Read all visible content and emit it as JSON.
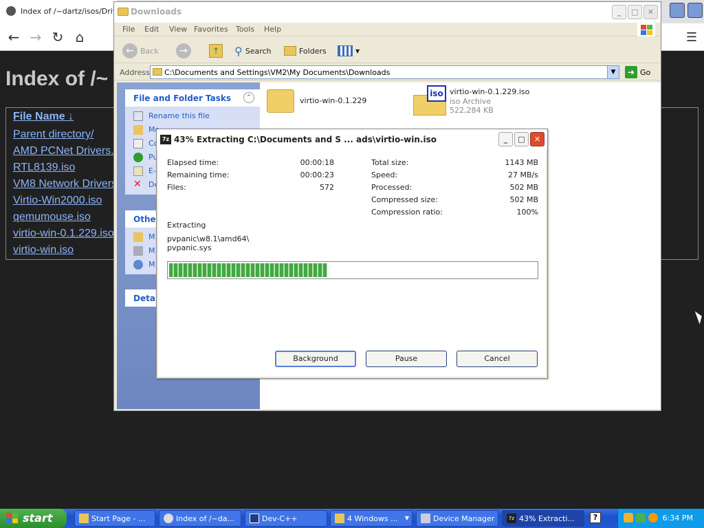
{
  "browser": {
    "tab_title": "Index of /~dartz/isos/Drivers",
    "page_heading": "Index of /~",
    "column_header": "File Name  ↓",
    "rows": [
      "Parent directory/",
      "AMD PCNet Drivers...",
      "RTL8139.iso",
      "VM8 Network Drivers",
      "Virtio-Win2000.iso",
      "qemumouse.iso",
      "virtio-win-0.1.229.iso",
      "virtio-win.iso"
    ]
  },
  "explorer": {
    "title": "Downloads",
    "menu": [
      "File",
      "Edit",
      "View",
      "Favorites",
      "Tools",
      "Help"
    ],
    "toolbar": {
      "back": "Back",
      "search": "Search",
      "folders": "Folders"
    },
    "address_label": "Address",
    "address_value": "C:\\Documents and Settings\\VM2\\My Documents\\Downloads",
    "go_label": "Go",
    "tasks_header": "File and Folder Tasks",
    "tasks": [
      "Rename this file",
      "Move this file",
      "Copy this file",
      "Publish this file",
      "E-mail this file",
      "Delete this file"
    ],
    "tasks_visible": [
      "Rename this file",
      "Mo",
      "Co",
      "Pu",
      "E-",
      "De"
    ],
    "other_header": "Other",
    "other_items": [
      "M",
      "M",
      "M"
    ],
    "details_header": "Detail",
    "files": [
      {
        "name": "virtio-win-0.1.229",
        "type": "folder"
      },
      {
        "name": "virtio-win-0.1.229.iso",
        "type_label": "iso Archive",
        "size": "522,284 KB"
      }
    ]
  },
  "dialog": {
    "title": "43% Extracting C:\\Documents and S ... ads\\virtio-win.iso",
    "progress_percent": 43,
    "left_stats": [
      {
        "label": "Elapsed time:",
        "value": "00:00:18"
      },
      {
        "label": "Remaining time:",
        "value": "00:00:23"
      },
      {
        "label": "Files:",
        "value": "572"
      }
    ],
    "right_stats": [
      {
        "label": "Total size:",
        "value": "1143 MB"
      },
      {
        "label": "Speed:",
        "value": "27 MB/s"
      },
      {
        "label": "Processed:",
        "value": "502 MB"
      },
      {
        "label": "Compressed size:",
        "value": "502 MB"
      },
      {
        "label": "Compression ratio:",
        "value": "100%"
      }
    ],
    "status_label": "Extracting",
    "current_path": "pvpanic\\w8.1\\amd64\\",
    "current_file": "pvpanic.sys",
    "buttons": {
      "background": "Background",
      "pause": "Pause",
      "cancel": "Cancel"
    }
  },
  "taskbar": {
    "start_label": "start",
    "items": [
      "Start Page - ...",
      "Index of /~da...",
      "Dev-C++",
      "4 Windows ...",
      "Device Manager",
      "43% Extracti..."
    ],
    "clock": "6:34 PM"
  },
  "colors": {
    "xp_blue": "#245edb",
    "start_green": "#2d8e2d",
    "progress_green": "#42a842",
    "link_blue": "#8ab4f8"
  }
}
